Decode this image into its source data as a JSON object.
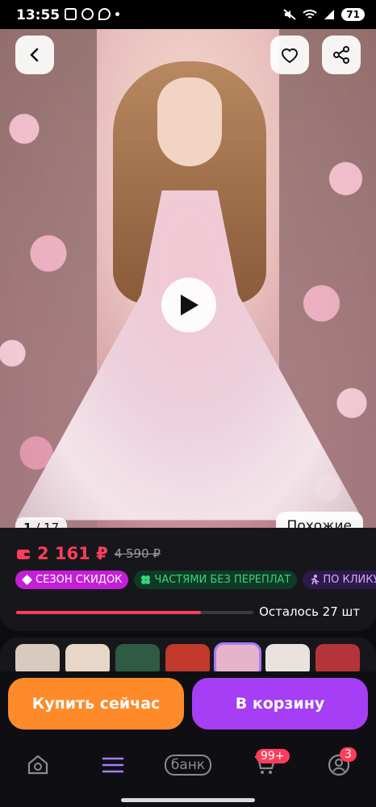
{
  "status_bar": {
    "time": "13:55",
    "battery": "71"
  },
  "gallery": {
    "counter_current": "1",
    "counter_total": "17",
    "similar_label": "Похожие",
    "thumb_colors": [
      "#d9cabf",
      "#e8d6c8",
      "#2f5a43",
      "#c0392b",
      "#e6b4c8",
      "#e9e2de",
      "#b5343a"
    ]
  },
  "product": {
    "price": "2 161 ₽",
    "old_price": "4 590 ₽",
    "chips": [
      {
        "label": "СЕЗОН СКИДОК"
      },
      {
        "label": "ЧАСТЯМИ БЕЗ ПЕРЕПЛАТ"
      },
      {
        "label": "ПО КЛИКУ"
      }
    ],
    "stock_label": "Осталось 27 шт",
    "stock_progress": 0.78
  },
  "actions": {
    "buy_now": "Купить сейчас",
    "add_to_cart": "В корзину"
  },
  "nav": {
    "bank_label": "банк",
    "cart_badge": "99+",
    "profile_badge": "3"
  },
  "colors": {
    "accent_red": "#ff3d5a",
    "buy_orange": "#ff8a2a",
    "cart_purple": "#a53ef5"
  }
}
